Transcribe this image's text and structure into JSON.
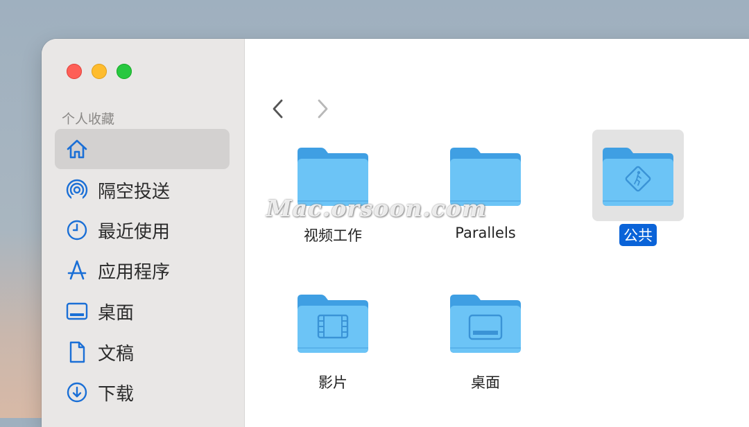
{
  "sidebar": {
    "section_title": "个人收藏",
    "items": [
      {
        "label": "",
        "icon": "home-icon",
        "selected": true
      },
      {
        "label": "隔空投送",
        "icon": "airdrop-icon"
      },
      {
        "label": "最近使用",
        "icon": "clock-icon"
      },
      {
        "label": "应用程序",
        "icon": "applications-icon"
      },
      {
        "label": "桌面",
        "icon": "desktop-icon"
      },
      {
        "label": "文稿",
        "icon": "document-icon"
      },
      {
        "label": "下载",
        "icon": "download-icon"
      }
    ]
  },
  "toolbar": {
    "back": "back-icon",
    "forward": "forward-icon"
  },
  "files": [
    {
      "label": "视频工作",
      "icon": "folder-icon"
    },
    {
      "label": "Parallels",
      "icon": "folder-icon"
    },
    {
      "label": "公共",
      "icon": "public-folder-icon",
      "selected": true
    },
    {
      "label": "影片",
      "icon": "movies-folder-icon"
    },
    {
      "label": "桌面",
      "icon": "desktop-folder-icon"
    }
  ],
  "watermark": "Mac.orsoon.com",
  "colors": {
    "accent": "#0a63d8",
    "folder": "#6cc4f6",
    "folder_tab": "#4aa9e8",
    "sidebar_icon": "#1a6fd6"
  }
}
